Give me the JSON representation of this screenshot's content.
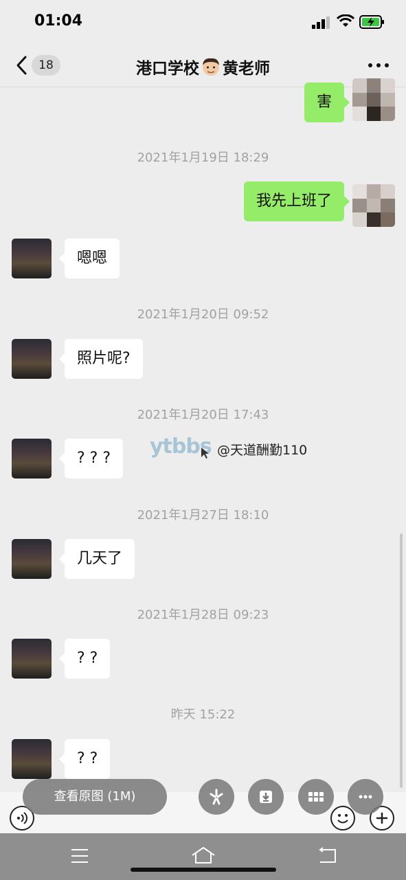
{
  "status_bar": {
    "time": "01:04"
  },
  "header": {
    "unread_count": "18",
    "title_left": "港口学校",
    "title_right": "黄老师"
  },
  "messages": [
    {
      "side": "out",
      "text": "害"
    },
    {
      "type": "timestamp",
      "text": "2021年1月19日 18:29"
    },
    {
      "side": "out",
      "text": "我先上班了"
    },
    {
      "side": "in",
      "text": "嗯嗯"
    },
    {
      "type": "timestamp",
      "text": "2021年1月20日 09:52"
    },
    {
      "side": "in",
      "text": "照片呢?"
    },
    {
      "type": "timestamp",
      "text": "2021年1月20日 17:43"
    },
    {
      "side": "in",
      "text": "? ? ?"
    },
    {
      "type": "timestamp",
      "text": "2021年1月27日 18:10"
    },
    {
      "side": "in",
      "text": "几天了"
    },
    {
      "type": "timestamp",
      "text": "2021年1月28日 09:23"
    },
    {
      "side": "in",
      "text": "? ?"
    },
    {
      "type": "timestamp",
      "text": "昨天 15:22"
    },
    {
      "side": "in",
      "text": "? ?"
    }
  ],
  "watermark": {
    "logo": "ytbbs",
    "handle": "@天道酬勤110"
  },
  "toolbar": {
    "view_original_label": "查看原图 (1M)"
  },
  "colors": {
    "outgoing_bubble": "#95ec69",
    "incoming_bubble": "#ffffff",
    "background": "#ededed"
  },
  "icons": [
    "back-chevron-icon",
    "more-dots-icon",
    "voice-icon",
    "emoji-icon",
    "plus-icon",
    "edit-sparkle-icon",
    "download-icon",
    "grid-icon",
    "more-circle-icon",
    "menu-icon",
    "home-icon",
    "back-icon"
  ]
}
